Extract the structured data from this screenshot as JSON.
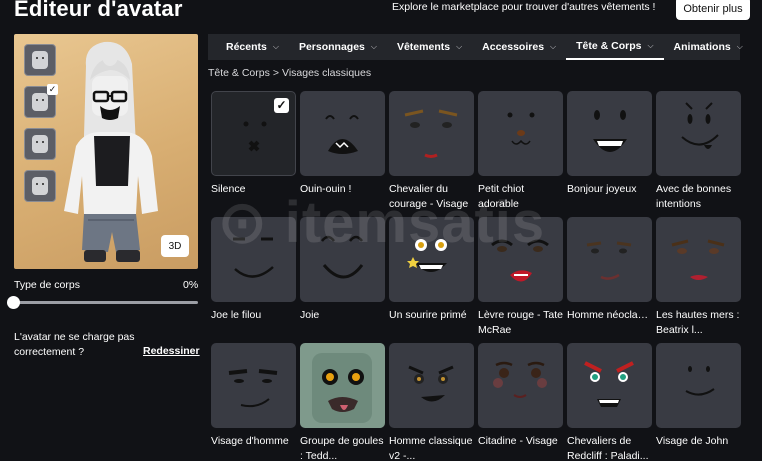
{
  "header": {
    "title": "Éditeur d'avatar",
    "promo_text": "Explore le marketplace pour trouver d'autres vêtements !",
    "obtain_button": "Obtenir plus"
  },
  "avatar": {
    "view_toggle": "3D",
    "body_type_label": "Type de corps",
    "body_type_value": "0%",
    "body_type_level": 0,
    "load_message": "L'avatar ne se charge pas correctement ?",
    "redraw_link": "Redessiner"
  },
  "tabs": [
    {
      "label": "Récents",
      "active": false
    },
    {
      "label": "Personnages",
      "active": false
    },
    {
      "label": "Vêtements",
      "active": false
    },
    {
      "label": "Accessoires",
      "active": false
    },
    {
      "label": "Tête & Corps",
      "active": true
    },
    {
      "label": "Animations",
      "active": false
    }
  ],
  "breadcrumb": {
    "parent": "Tête & Corps",
    "separator": ">",
    "current": "Visages classiques"
  },
  "items": [
    {
      "name": "Silence",
      "selected": true
    },
    {
      "name": "Ouin-ouin !"
    },
    {
      "name": "Chevalier du courage - Visage"
    },
    {
      "name": "Petit chiot adorable"
    },
    {
      "name": "Bonjour joyeux"
    },
    {
      "name": "Avec de bonnes intentions"
    },
    {
      "name": "Joe le filou"
    },
    {
      "name": "Joie"
    },
    {
      "name": "Un sourire primé"
    },
    {
      "name": "Lèvre rouge - Tate McRae"
    },
    {
      "name": "Homme néoclassique v..."
    },
    {
      "name": "Les hautes mers : Beatrix l..."
    },
    {
      "name": "Visage d'homme"
    },
    {
      "name": "Groupe de goules : Tedd..."
    },
    {
      "name": "Homme classique v2 -..."
    },
    {
      "name": "Citadine - Visage"
    },
    {
      "name": "Chevaliers de Redcliff : Paladi..."
    },
    {
      "name": "Visage de John"
    }
  ],
  "watermark": "itemsatis",
  "colors": {
    "background": "#111216",
    "tile": "#393b43",
    "tab_bar": "#24262b",
    "avatar_bg": "#d8ae72"
  }
}
